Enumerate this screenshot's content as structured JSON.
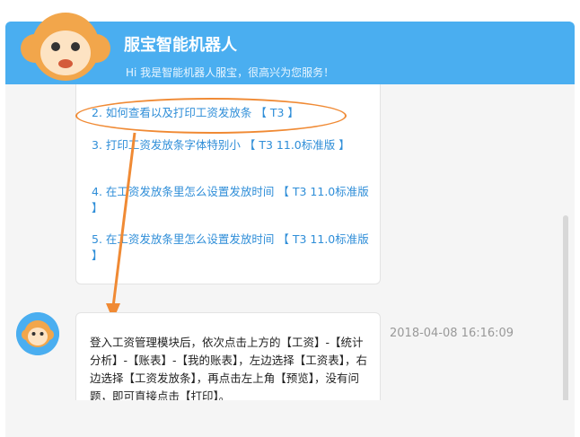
{
  "header": {
    "title": "服宝智能机器人",
    "subtitle": "Hi 我是智能机器人服宝，很高兴为您服务！"
  },
  "faq_items": [
    {
      "label": "2. 如何查看以及打印工资发放条 【 T3 】"
    },
    {
      "label": "3. 打印工资发放条字体特别小 【 T3 11.0标准版 】"
    },
    {
      "label": "4. 在工资发放条里怎么设置发放时间 【 T3 11.0标准版 】"
    },
    {
      "label": "5. 在工资发放条里怎么设置发放时间 【 T3 11.0标准版 】"
    }
  ],
  "answer": {
    "text": "登入工资管理模块后，依次点击上方的【工资】-【统计分析】-【账表】-【我的账表】，左边选择【工资表】，右边选择【工资发放条】，再点击左上角【预览】，没有问题，即可直接点击【打印】。",
    "time": "2018-04-08 16:16:09"
  },
  "colors": {
    "header_bg": "#4aaef0",
    "link": "#2f8ed8",
    "annotation": "#f08a34"
  }
}
